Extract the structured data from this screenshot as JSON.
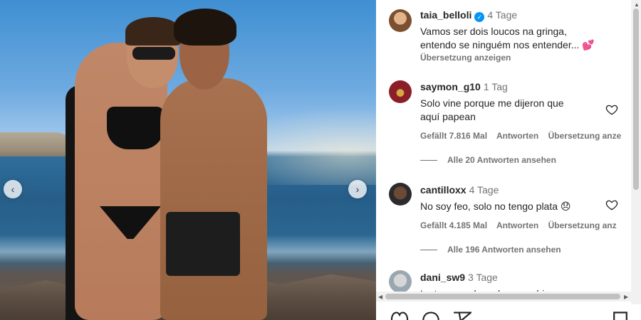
{
  "post": {
    "author": "taia_belloli",
    "time": "4 Tage",
    "caption_line1": "Vamos ser dois loucos na gringa,",
    "caption_line2": "entendo se ninguém nos entender...",
    "caption_emoji": "💕",
    "translate": "Übersetzung anzeigen"
  },
  "comments": [
    {
      "user": "saymon_g10",
      "time": "1 Tag",
      "text_line1": "Solo vine porque me dijeron que",
      "text_line2": "aquí papean",
      "likes": "Gefällt 7.816 Mal",
      "reply": "Antworten",
      "translate": "Übersetzung anze",
      "view_replies": "Alle 20 Antworten ansehen"
    },
    {
      "user": "cantilloxx",
      "time": "4 Tage",
      "text": "No soy feo, solo no tengo plata",
      "emoji": "😞",
      "likes": "Gefällt 4.185 Mal",
      "reply": "Antworten",
      "translate": "Übersetzung anz",
      "view_replies": "Alle 196 Antworten ansehen"
    },
    {
      "user": "dani_sw9",
      "time": "3 Tage",
      "text_partial": "La temporada se larga rechi"
    }
  ],
  "icons": {
    "verified": "verified-badge-icon",
    "heart": "heart-outline-icon",
    "prev": "chevron-left-icon",
    "next": "chevron-right-icon",
    "actions": [
      "like-icon",
      "comment-icon",
      "share-icon",
      "save-icon"
    ]
  },
  "colors": {
    "verified": "#0095f6",
    "text": "#262626",
    "secondary": "#737373"
  }
}
